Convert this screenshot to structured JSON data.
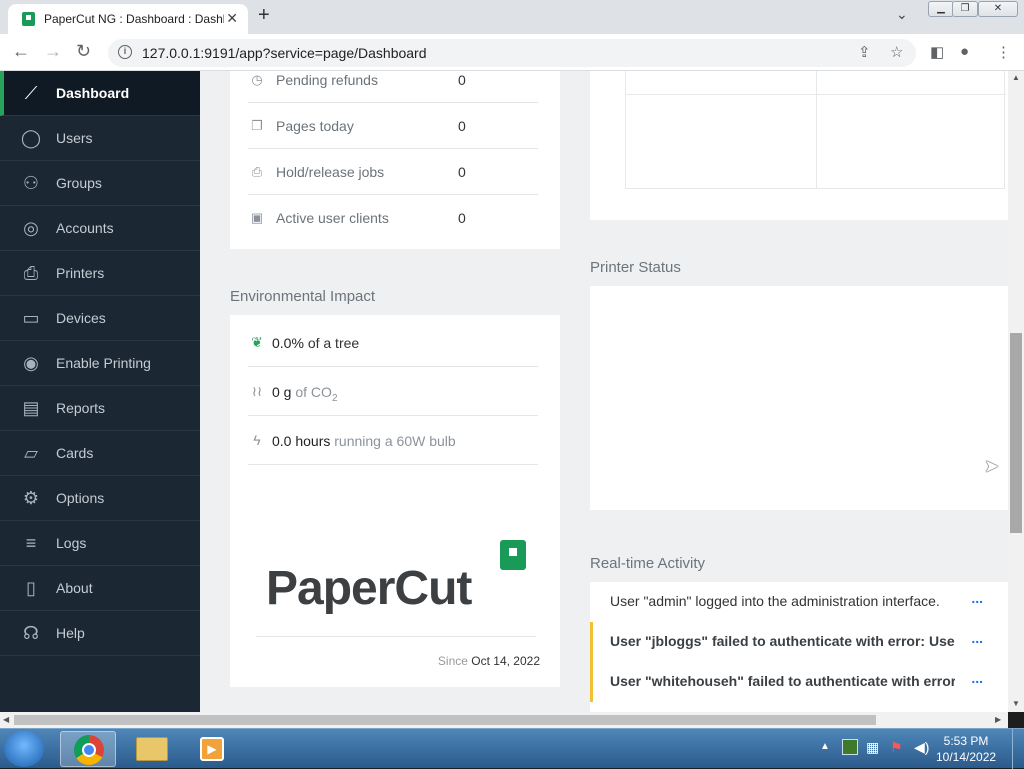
{
  "browser": {
    "tab_title": "PaperCut NG : Dashboard : Dashboard",
    "url": "127.0.0.1:9191/app?service=page/Dashboard"
  },
  "sidebar": {
    "items": [
      {
        "label": "Dashboard",
        "icon": "chart-line-icon",
        "glyph": "⟋",
        "active": true
      },
      {
        "label": "Users",
        "icon": "user-icon",
        "glyph": "◯"
      },
      {
        "label": "Groups",
        "icon": "group-icon",
        "glyph": "⚇"
      },
      {
        "label": "Accounts",
        "icon": "accounts-icon",
        "glyph": "◎"
      },
      {
        "label": "Printers",
        "icon": "printer-icon",
        "glyph": "⎙"
      },
      {
        "label": "Devices",
        "icon": "device-icon",
        "glyph": "▭"
      },
      {
        "label": "Enable Printing",
        "icon": "enable-printing-icon",
        "glyph": "◉"
      },
      {
        "label": "Reports",
        "icon": "report-icon",
        "glyph": "▤"
      },
      {
        "label": "Cards",
        "icon": "card-icon",
        "glyph": "▱"
      },
      {
        "label": "Options",
        "icon": "gear-icon",
        "glyph": "⚙"
      },
      {
        "label": "Logs",
        "icon": "logs-icon",
        "glyph": "≡"
      },
      {
        "label": "About",
        "icon": "book-icon",
        "glyph": "▯"
      },
      {
        "label": "Help",
        "icon": "headset-icon",
        "glyph": "☊"
      }
    ]
  },
  "stats": [
    {
      "label": "Pending refunds",
      "value": "0",
      "icon": "clock-icon",
      "glyph": "◷"
    },
    {
      "label": "Pages today",
      "value": "0",
      "icon": "pages-icon",
      "glyph": "❐"
    },
    {
      "label": "Hold/release jobs",
      "value": "0",
      "icon": "print-job-icon",
      "glyph": "⎙"
    },
    {
      "label": "Active user clients",
      "value": "0",
      "icon": "client-icon",
      "glyph": "▣"
    }
  ],
  "environmental": {
    "title": "Environmental Impact",
    "tree": {
      "value": "0.0%",
      "text": "of a tree"
    },
    "co2": {
      "value": "0 g",
      "text": "of CO",
      "sub": "2"
    },
    "bulb": {
      "value": "0.0 hours",
      "text": "running a 60W bulb"
    },
    "logo_text": "PaperCut",
    "since_label": "Since",
    "since_date": "Oct 14, 2022"
  },
  "printer_status": {
    "title": "Printer Status"
  },
  "activity": {
    "title": "Real-time Activity",
    "items": [
      {
        "text": "User \"admin\" logged into the administration interface.",
        "type": "info"
      },
      {
        "text": "User \"jbloggs\" failed to authenticate with error: User",
        "type": "warn"
      },
      {
        "text": "User \"whitehouseh\" failed to authenticate with error:",
        "type": "warn"
      }
    ],
    "more_label": "..."
  },
  "taskbar": {
    "time": "5:53 PM",
    "date": "10/14/2022"
  },
  "colors": {
    "sidebar_bg": "#1b2733",
    "accent_green": "#27a35a",
    "warn_yellow": "#f2c037"
  }
}
